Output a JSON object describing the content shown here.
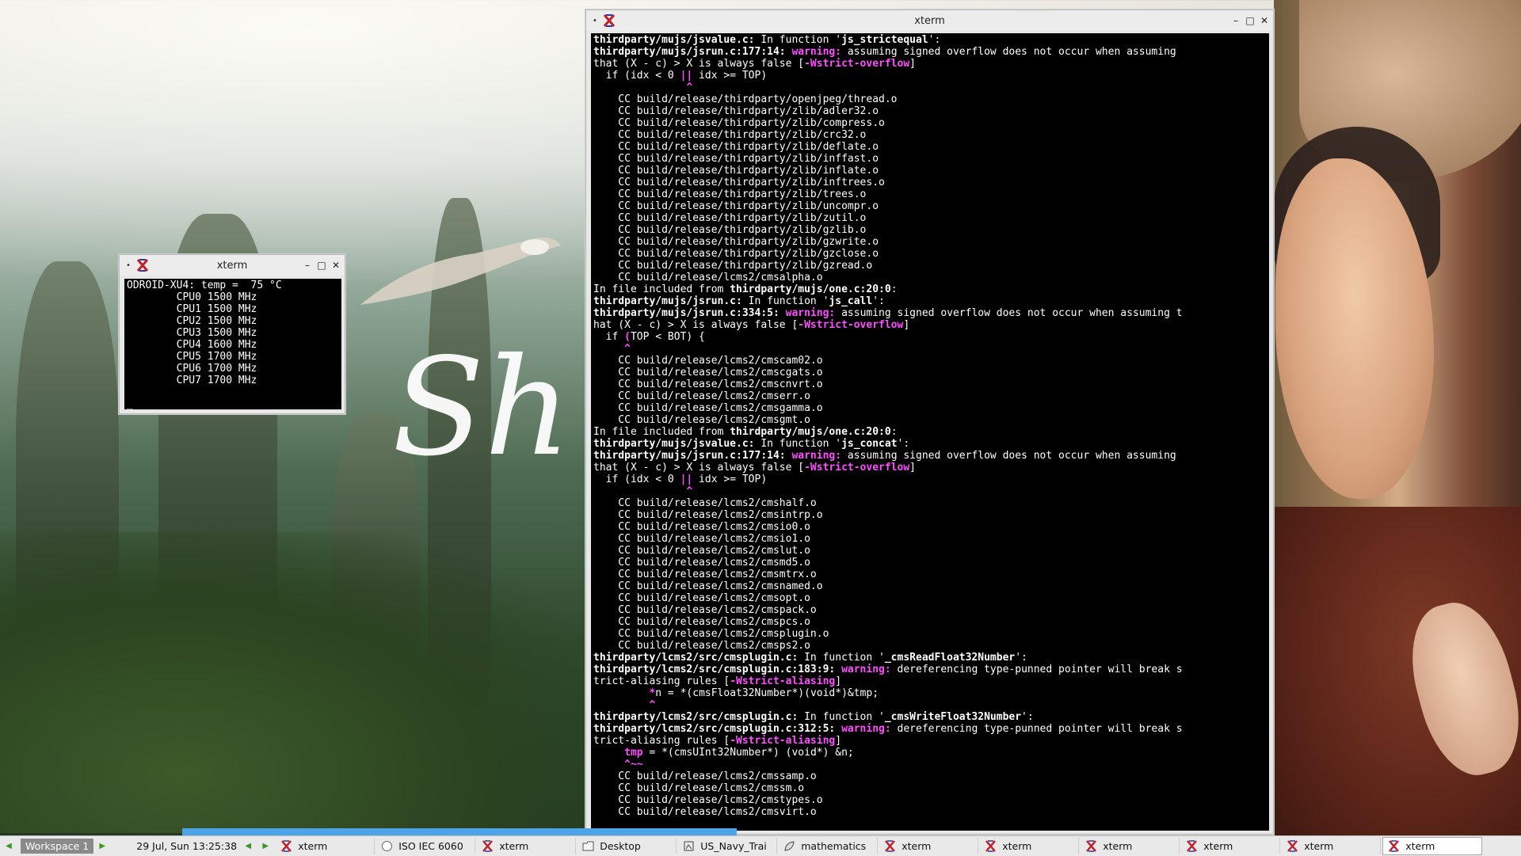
{
  "wallpaper": {
    "script_text": "Sh"
  },
  "small_xterm": {
    "title": "xterm",
    "lines": [
      "ODROID-XU4: temp =  75 °C",
      "        CPU0 1500 MHz",
      "        CPU1 1500 MHz",
      "        CPU2 1500 MHz",
      "        CPU3 1500 MHz",
      "        CPU4 1600 MHz",
      "        CPU5 1700 MHz",
      "        CPU6 1700 MHz",
      "        CPU7 1700 MHz",
      "",
      "_"
    ]
  },
  "main_xterm": {
    "title": "xterm",
    "lines": [
      [
        {
          "t": "thirdparty/mujs/jsvalue.c:",
          "s": "b"
        },
        {
          "t": " In function '"
        },
        {
          "t": "js_strictequal",
          "s": "b"
        },
        {
          "t": "':"
        }
      ],
      [
        {
          "t": "thirdparty/mujs/jsrun.c:177:14: ",
          "s": "b"
        },
        {
          "t": "warning:",
          "s": "m"
        },
        {
          "t": " assuming signed overflow does not occur when assuming"
        }
      ],
      [
        {
          "t": "that (X - c) > X is always false ["
        },
        {
          "t": "-Wstrict-overflow",
          "s": "m"
        },
        {
          "t": "]"
        }
      ],
      [
        {
          "t": "  if (idx < 0 "
        },
        {
          "t": "||",
          "s": "m"
        },
        {
          "t": " idx >= TOP)"
        }
      ],
      [
        {
          "t": "               ",
          "s": ""
        },
        {
          "t": "^",
          "s": "m"
        }
      ],
      [
        {
          "t": "    CC build/release/thirdparty/openjpeg/thread.o"
        }
      ],
      [
        {
          "t": "    CC build/release/thirdparty/zlib/adler32.o"
        }
      ],
      [
        {
          "t": "    CC build/release/thirdparty/zlib/compress.o"
        }
      ],
      [
        {
          "t": "    CC build/release/thirdparty/zlib/crc32.o"
        }
      ],
      [
        {
          "t": "    CC build/release/thirdparty/zlib/deflate.o"
        }
      ],
      [
        {
          "t": "    CC build/release/thirdparty/zlib/inffast.o"
        }
      ],
      [
        {
          "t": "    CC build/release/thirdparty/zlib/inflate.o"
        }
      ],
      [
        {
          "t": "    CC build/release/thirdparty/zlib/inftrees.o"
        }
      ],
      [
        {
          "t": "    CC build/release/thirdparty/zlib/trees.o"
        }
      ],
      [
        {
          "t": "    CC build/release/thirdparty/zlib/uncompr.o"
        }
      ],
      [
        {
          "t": "    CC build/release/thirdparty/zlib/zutil.o"
        }
      ],
      [
        {
          "t": "    CC build/release/thirdparty/zlib/gzlib.o"
        }
      ],
      [
        {
          "t": "    CC build/release/thirdparty/zlib/gzwrite.o"
        }
      ],
      [
        {
          "t": "    CC build/release/thirdparty/zlib/gzclose.o"
        }
      ],
      [
        {
          "t": "    CC build/release/thirdparty/zlib/gzread.o"
        }
      ],
      [
        {
          "t": "    CC build/release/lcms2/cmsalpha.o"
        }
      ],
      [
        {
          "t": "In file included from "
        },
        {
          "t": "thirdparty/mujs/one.c:20:0",
          "s": "b"
        },
        {
          "t": ":"
        }
      ],
      [
        {
          "t": "thirdparty/mujs/jsrun.c:",
          "s": "b"
        },
        {
          "t": " In function '"
        },
        {
          "t": "js_call",
          "s": "b"
        },
        {
          "t": "':"
        }
      ],
      [
        {
          "t": "thirdparty/mujs/jsrun.c:334:5: ",
          "s": "b"
        },
        {
          "t": "warning:",
          "s": "m"
        },
        {
          "t": " assuming signed overflow does not occur when assuming t"
        }
      ],
      [
        {
          "t": "hat (X - c) > X is always false ["
        },
        {
          "t": "-Wstrict-overflow",
          "s": "m"
        },
        {
          "t": "]"
        }
      ],
      [
        {
          "t": "  if "
        },
        {
          "t": "(",
          "s": "m"
        },
        {
          "t": "TOP < BOT) {"
        }
      ],
      [
        {
          "t": "     "
        },
        {
          "t": "^",
          "s": "m"
        }
      ],
      [
        {
          "t": "    CC build/release/lcms2/cmscam02.o"
        }
      ],
      [
        {
          "t": "    CC build/release/lcms2/cmscgats.o"
        }
      ],
      [
        {
          "t": "    CC build/release/lcms2/cmscnvrt.o"
        }
      ],
      [
        {
          "t": "    CC build/release/lcms2/cmserr.o"
        }
      ],
      [
        {
          "t": "    CC build/release/lcms2/cmsgamma.o"
        }
      ],
      [
        {
          "t": "    CC build/release/lcms2/cmsgmt.o"
        }
      ],
      [
        {
          "t": "In file included from "
        },
        {
          "t": "thirdparty/mujs/one.c:20:0",
          "s": "b"
        },
        {
          "t": ":"
        }
      ],
      [
        {
          "t": "thirdparty/mujs/jsvalue.c:",
          "s": "b"
        },
        {
          "t": " In function '"
        },
        {
          "t": "js_concat",
          "s": "b"
        },
        {
          "t": "':"
        }
      ],
      [
        {
          "t": "thirdparty/mujs/jsrun.c:177:14: ",
          "s": "b"
        },
        {
          "t": "warning:",
          "s": "m"
        },
        {
          "t": " assuming signed overflow does not occur when assuming"
        }
      ],
      [
        {
          "t": "that (X - c) > X is always false ["
        },
        {
          "t": "-Wstrict-overflow",
          "s": "m"
        },
        {
          "t": "]"
        }
      ],
      [
        {
          "t": "  if (idx < 0 "
        },
        {
          "t": "||",
          "s": "m"
        },
        {
          "t": " idx >= TOP)"
        }
      ],
      [
        {
          "t": "               "
        },
        {
          "t": "^",
          "s": "m"
        }
      ],
      [
        {
          "t": "    CC build/release/lcms2/cmshalf.o"
        }
      ],
      [
        {
          "t": "    CC build/release/lcms2/cmsintrp.o"
        }
      ],
      [
        {
          "t": "    CC build/release/lcms2/cmsio0.o"
        }
      ],
      [
        {
          "t": "    CC build/release/lcms2/cmsio1.o"
        }
      ],
      [
        {
          "t": "    CC build/release/lcms2/cmslut.o"
        }
      ],
      [
        {
          "t": "    CC build/release/lcms2/cmsmd5.o"
        }
      ],
      [
        {
          "t": "    CC build/release/lcms2/cmsmtrx.o"
        }
      ],
      [
        {
          "t": "    CC build/release/lcms2/cmsnamed.o"
        }
      ],
      [
        {
          "t": "    CC build/release/lcms2/cmsopt.o"
        }
      ],
      [
        {
          "t": "    CC build/release/lcms2/cmspack.o"
        }
      ],
      [
        {
          "t": "    CC build/release/lcms2/cmspcs.o"
        }
      ],
      [
        {
          "t": "    CC build/release/lcms2/cmsplugin.o"
        }
      ],
      [
        {
          "t": "    CC build/release/lcms2/cmsps2.o"
        }
      ],
      [
        {
          "t": "thirdparty/lcms2/src/cmsplugin.c:",
          "s": "b"
        },
        {
          "t": " In function '"
        },
        {
          "t": "_cmsReadFloat32Number",
          "s": "b"
        },
        {
          "t": "':"
        }
      ],
      [
        {
          "t": "thirdparty/lcms2/src/cmsplugin.c:183:9: ",
          "s": "b"
        },
        {
          "t": "warning:",
          "s": "m"
        },
        {
          "t": " dereferencing type-punned pointer will break s"
        }
      ],
      [
        {
          "t": "trict-aliasing rules ["
        },
        {
          "t": "-Wstrict-aliasing",
          "s": "m"
        },
        {
          "t": "]"
        }
      ],
      [
        {
          "t": "         "
        },
        {
          "t": "*",
          "s": "m"
        },
        {
          "t": "n = *(cmsFloat32Number*)(void*)&tmp;"
        }
      ],
      [
        {
          "t": "         "
        },
        {
          "t": "^",
          "s": "m"
        }
      ],
      [
        {
          "t": "thirdparty/lcms2/src/cmsplugin.c:",
          "s": "b"
        },
        {
          "t": " In function '"
        },
        {
          "t": "_cmsWriteFloat32Number",
          "s": "b"
        },
        {
          "t": "':"
        }
      ],
      [
        {
          "t": "thirdparty/lcms2/src/cmsplugin.c:312:5: ",
          "s": "b"
        },
        {
          "t": "warning:",
          "s": "m"
        },
        {
          "t": " dereferencing type-punned pointer will break s"
        }
      ],
      [
        {
          "t": "trict-aliasing rules ["
        },
        {
          "t": "-Wstrict-aliasing",
          "s": "m"
        },
        {
          "t": "]"
        }
      ],
      [
        {
          "t": "     "
        },
        {
          "t": "tmp",
          "s": "m"
        },
        {
          "t": " = *(cmsUInt32Number*) (void*) &n;"
        }
      ],
      [
        {
          "t": "     "
        },
        {
          "t": "^~~",
          "s": "m"
        }
      ],
      [
        {
          "t": "    CC build/release/lcms2/cmssamp.o"
        }
      ],
      [
        {
          "t": "    CC build/release/lcms2/cmssm.o"
        }
      ],
      [
        {
          "t": "    CC build/release/lcms2/cmstypes.o"
        }
      ],
      [
        {
          "t": "    CC build/release/lcms2/cmsvirt.o"
        }
      ]
    ]
  },
  "taskbar": {
    "workspace_label": "Workspace 1",
    "clock": "29 Jul, Sun 13:25:38",
    "tasks": [
      {
        "label": "xterm",
        "icon": "xterm-icon",
        "active": false
      },
      {
        "label": "ISO IEC 6060",
        "icon": "document-icon",
        "active": false
      },
      {
        "label": "xterm",
        "icon": "xterm-icon",
        "active": false
      },
      {
        "label": "Desktop",
        "icon": "folder-icon",
        "active": false
      },
      {
        "label": "US_Navy_Trai",
        "icon": "image-viewer-icon",
        "active": false
      },
      {
        "label": "mathematics",
        "icon": "leaf-icon",
        "active": false
      },
      {
        "label": "xterm",
        "icon": "xterm-icon",
        "active": false
      },
      {
        "label": "xterm",
        "icon": "xterm-icon",
        "active": false
      },
      {
        "label": "xterm",
        "icon": "xterm-icon",
        "active": false
      },
      {
        "label": "xterm",
        "icon": "xterm-icon",
        "active": false
      },
      {
        "label": "xterm",
        "icon": "xterm-icon",
        "active": false
      },
      {
        "label": "xterm",
        "icon": "xterm-icon",
        "active": true
      }
    ]
  },
  "colors": {
    "warning_magenta": "#ff4dff",
    "taskbar_arrow": "#3a9a20",
    "terminal_bg": "#000000"
  }
}
